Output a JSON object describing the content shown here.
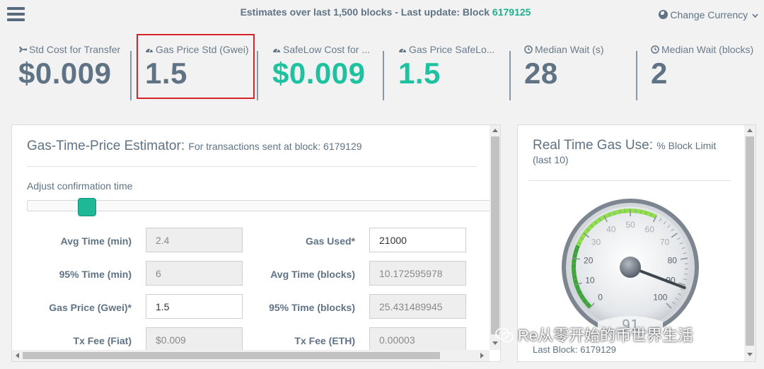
{
  "header": {
    "title_prefix": "Estimates over last 1,500 blocks - Last update: Block ",
    "block": "6179125",
    "change_currency": "Change Currency"
  },
  "stats": [
    {
      "label": "Std Cost for Transfer",
      "value": "$0.009",
      "icon": "plane-icon"
    },
    {
      "label": "Gas Price Std (Gwei)",
      "value": "1.5",
      "icon": "tachometer-icon"
    },
    {
      "label": "SafeLow Cost for ...",
      "value": "$0.009",
      "icon": "tachometer-icon"
    },
    {
      "label": "Gas Price SafeLo...",
      "value": "1.5",
      "icon": "tachometer-icon"
    },
    {
      "label": "Median Wait (s)",
      "value": "28",
      "icon": "clock-icon"
    },
    {
      "label": "Median Wait (blocks)",
      "value": "2",
      "icon": "clock-icon"
    }
  ],
  "estimator": {
    "title": "Gas-Time-Price Estimator:",
    "subtitle": "For transactions sent at block: 6179129",
    "adjust_label": "Adjust confirmation time",
    "fields": {
      "avg_time_min": {
        "label": "Avg Time (min)",
        "value": "2.4"
      },
      "p95_time_min": {
        "label": "95% Time (min)",
        "value": "6"
      },
      "gas_price": {
        "label": "Gas Price (Gwei)*",
        "value": "1.5"
      },
      "tx_fee_fiat": {
        "label": "Tx Fee (Fiat)",
        "value": "$0.009"
      },
      "gas_used": {
        "label": "Gas Used*",
        "value": "21000"
      },
      "avg_time_blocks": {
        "label": "Avg Time (blocks)",
        "value": "10.172595978"
      },
      "p95_time_blocks": {
        "label": "95% Time (blocks)",
        "value": "25.431489945"
      },
      "tx_fee_eth": {
        "label": "Tx Fee (ETH)",
        "value": "0.00003"
      }
    }
  },
  "realtime": {
    "title": "Real Time Gas Use:",
    "subtitle": "% Block Limit (last 10)",
    "gauge_ticks": [
      "0",
      "10",
      "20",
      "30",
      "40",
      "50",
      "60",
      "70",
      "80",
      "90",
      "100"
    ],
    "gauge_value": 91,
    "gauge_readout": "91",
    "last_block": "Last Block: 6179129"
  },
  "watermark": "Re从零开始的币世界生活",
  "colors": {
    "accent": "#1fc2a0",
    "text": "#5f7385",
    "highlight": "#d8212a"
  }
}
